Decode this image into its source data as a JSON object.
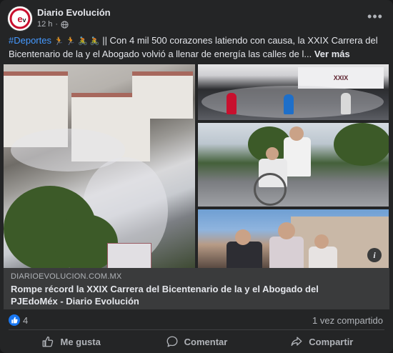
{
  "post": {
    "page_name": "Diario Evolución",
    "time": "12 h",
    "audience_icon": "globe-icon",
    "more_icon": "more-options-icon",
    "avatar_logo": "ev"
  },
  "caption": {
    "hashtag": "#Deportes",
    "emojis": "🏃 🏃 🚴 🚴",
    "text": " || Con 4 mil 500 corazones latiendo con causa, la XXIX Carrera del Bicentenario de la y el Abogado volvió a llenar de energía las calles de l...",
    "see_more": "Ver más"
  },
  "images": {
    "banner_text": "XXIX",
    "info_icon": "i"
  },
  "link": {
    "domain": "DIARIOEVOLUCION.COM.MX",
    "title": "Rompe récord la XXIX Carrera del Bicentenario de la y el Abogado del PJEdoMéx - Diario Evolución"
  },
  "stats": {
    "likes": "4",
    "shares": "1 vez compartido"
  },
  "actions": {
    "like": "Me gusta",
    "comment": "Comentar",
    "share": "Compartir"
  },
  "colors": {
    "background": "#242526",
    "accent_blue": "#1877f2",
    "hashtag_blue": "#4599ff",
    "text_primary": "#e4e6eb",
    "text_secondary": "#b0b3b8"
  }
}
